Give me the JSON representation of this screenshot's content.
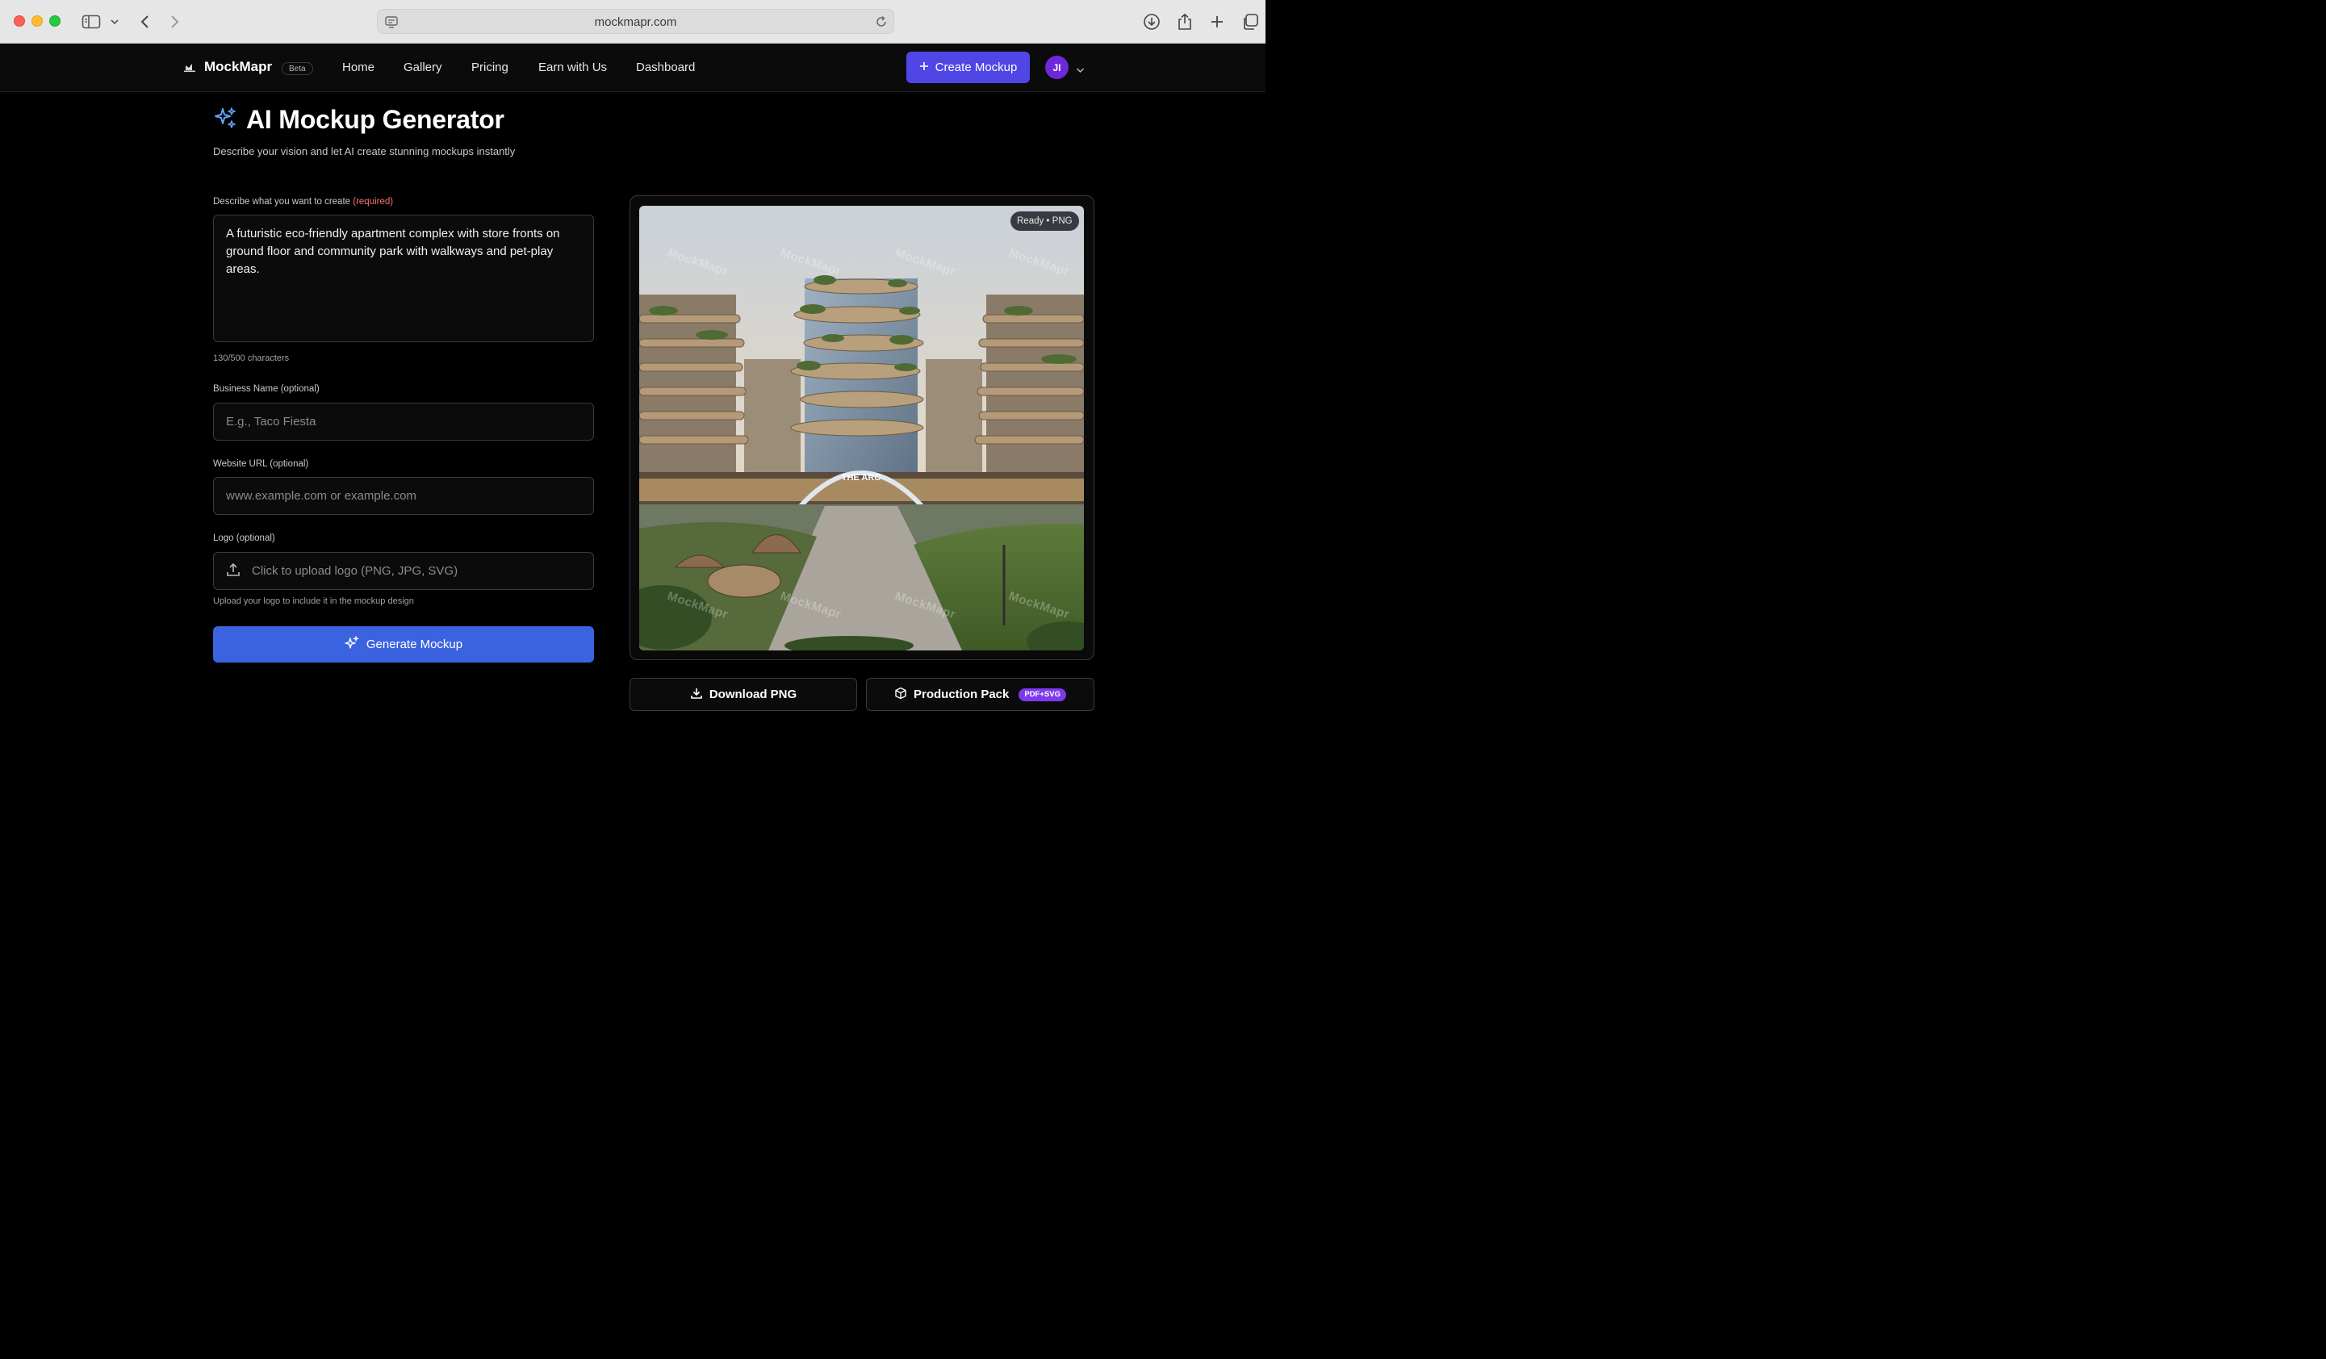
{
  "browser": {
    "url": "mockmapr.com"
  },
  "nav": {
    "brand": "MockMapr",
    "beta": "Beta",
    "links": [
      "Home",
      "Gallery",
      "Pricing",
      "Earn with Us",
      "Dashboard"
    ],
    "create_button": "Create Mockup",
    "avatar_initials": "JI"
  },
  "main": {
    "title": "AI Mockup Generator",
    "subtitle": "Describe your vision and let AI create stunning mockups instantly",
    "description_label": "Describe what you want to create",
    "description_required": "(required)",
    "description_value": "A futuristic eco-friendly apartment complex with store fronts on ground floor and community park with walkways and pet-play areas.",
    "char_count": "130/500 characters",
    "business_label": "Business Name (optional)",
    "business_placeholder": "E.g., Taco Fiesta",
    "website_label": "Website URL (optional)",
    "website_placeholder": "www.example.com or example.com",
    "logo_label": "Logo (optional)",
    "logo_upload_text": "Click to upload logo (PNG, JPG, SVG)",
    "logo_help": "Upload your logo to include it in the mockup design",
    "generate_button": "Generate Mockup"
  },
  "preview": {
    "status": "Ready • PNG",
    "watermark": "MockMapr",
    "sign_text": "THE ARC",
    "download_button": "Download PNG",
    "pack_button": "Production Pack",
    "pack_badge": "PDF+SVG"
  },
  "colors": {
    "accent": "#4f46e5",
    "generate": "#3b63e0",
    "badge": "#7c3aed",
    "required": "#f87171"
  }
}
